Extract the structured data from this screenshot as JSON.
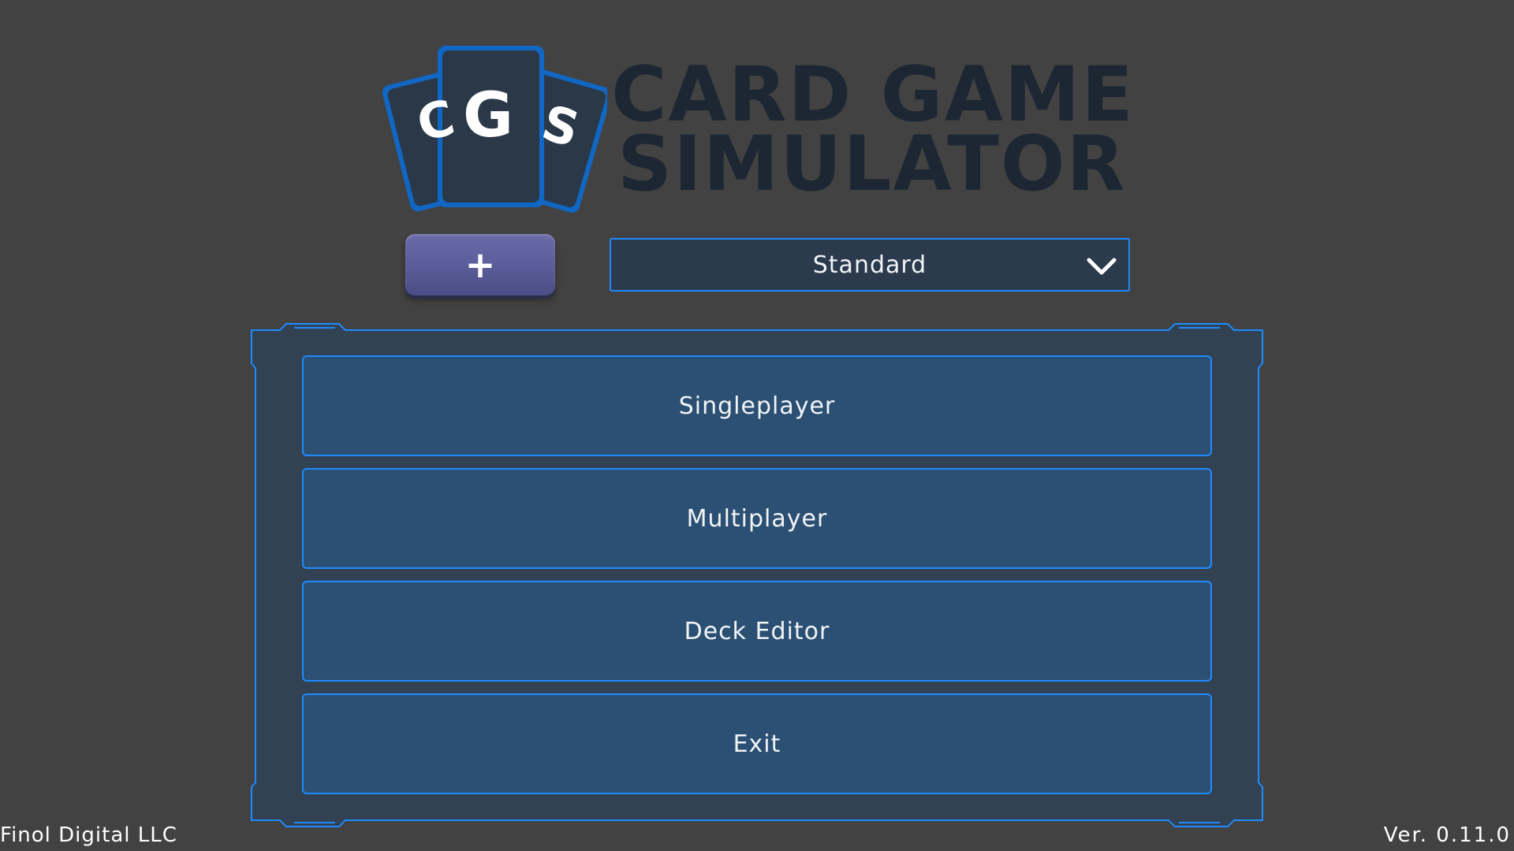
{
  "logo": {
    "letters": [
      "C",
      "G",
      "S"
    ],
    "title_line_1": "CARD GAME",
    "title_line_2": "SIMULATOR"
  },
  "top_controls": {
    "add_button_label": "+",
    "game_selector": {
      "selected": "Standard",
      "icon": "chevron-down-icon"
    }
  },
  "main_menu": {
    "items": [
      {
        "label": "Singleplayer"
      },
      {
        "label": "Multiplayer"
      },
      {
        "label": "Deck Editor"
      },
      {
        "label": "Exit"
      }
    ]
  },
  "footer": {
    "company": "Finol Digital LLC",
    "version": "Ver. 0.11.0"
  },
  "colors": {
    "background": "#424242",
    "accent_border": "#1d8bff",
    "menu_button": "#2b5073",
    "dropdown_fill": "#2b3a4d",
    "logo_dark": "#1d2733",
    "add_button": "#5a5c99"
  }
}
